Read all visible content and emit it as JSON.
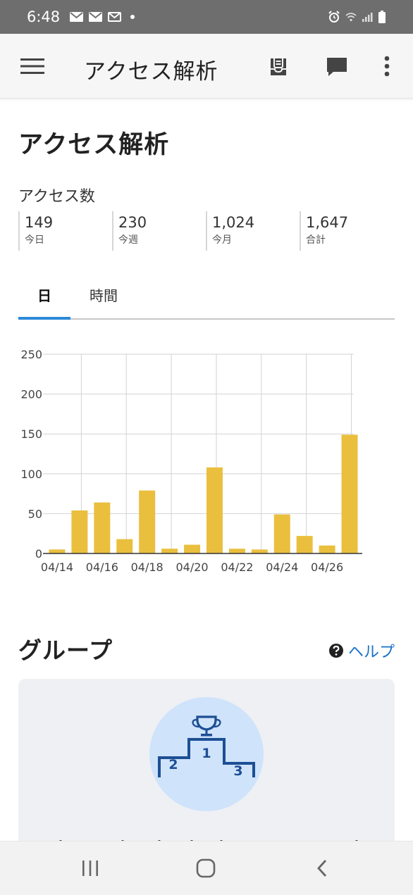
{
  "status_bar": {
    "time": "6:48",
    "notification_icons": [
      "mail-icon",
      "mail-icon",
      "mail-open-icon",
      "dot-icon"
    ],
    "right_icons": [
      "alarm-icon",
      "wifi-icon",
      "signal-icon",
      "battery-icon"
    ]
  },
  "app_bar": {
    "title": "アクセス解析",
    "icons": [
      "menu-icon",
      "inbox-icon",
      "chat-icon",
      "more-vert-icon"
    ]
  },
  "page": {
    "title": "アクセス解析",
    "access_label": "アクセス数",
    "stats": [
      {
        "value": "149",
        "label": "今日"
      },
      {
        "value": "230",
        "label": "今週"
      },
      {
        "value": "1,024",
        "label": "今月"
      },
      {
        "value": "1,647",
        "label": "合計"
      }
    ],
    "tabs": [
      {
        "label": "日",
        "active": true
      },
      {
        "label": "時間",
        "active": false
      }
    ]
  },
  "chart_data": {
    "type": "bar",
    "categories": [
      "04/14",
      "04/15",
      "04/16",
      "04/17",
      "04/18",
      "04/19",
      "04/20",
      "04/21",
      "04/22",
      "04/23",
      "04/24",
      "04/25",
      "04/26",
      "04/27"
    ],
    "x_tick_labels": [
      "04/14",
      "04/16",
      "04/18",
      "04/20",
      "04/22",
      "04/24",
      "04/26"
    ],
    "values": [
      5,
      54,
      64,
      18,
      79,
      6,
      11,
      108,
      6,
      5,
      49,
      22,
      10,
      149
    ],
    "ylim": [
      0,
      250
    ],
    "y_ticks": [
      0,
      50,
      100,
      150,
      200,
      250
    ],
    "grid": true,
    "bar_color": "#eabf3e",
    "title": "",
    "xlabel": "",
    "ylabel": ""
  },
  "group_section": {
    "title": "グループ",
    "help_label": "ヘルプ",
    "podium": {
      "first": "1",
      "second": "2",
      "third": "3"
    }
  },
  "colors": {
    "accent": "#2b8ad8",
    "link": "#1a73c6",
    "podium": "#1d4f94",
    "podium_bg": "#cfe3fb"
  }
}
